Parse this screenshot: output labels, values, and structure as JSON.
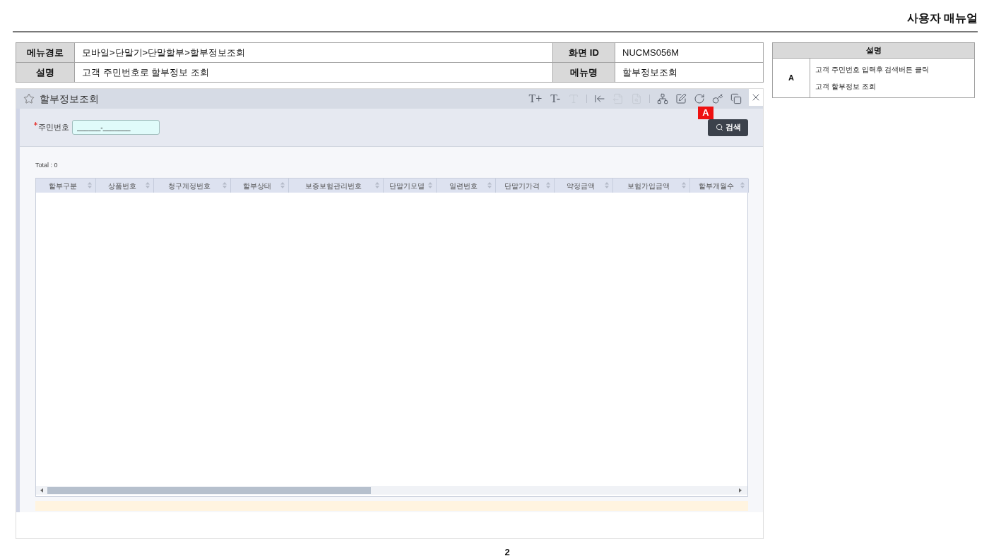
{
  "header": {
    "title": "사용자 매뉴얼"
  },
  "info_table": {
    "rows": [
      {
        "cells": [
          {
            "label": "메뉴경로",
            "value": "모바일>단말기>단말할부>할부정보조회"
          },
          {
            "label": "화면 ID",
            "value": "NUCMS056M"
          }
        ]
      },
      {
        "cells": [
          {
            "label": "설명",
            "value": "고객 주민번호로 할부정보 조회"
          },
          {
            "label": "메뉴명",
            "value": "할부정보조회"
          }
        ]
      }
    ]
  },
  "description_panel": {
    "title": "설명",
    "items": [
      {
        "marker": "A",
        "lines": [
          "고객 주민번호 입력후 검색버튼 클릭",
          "고객 할부정보 조회"
        ]
      }
    ]
  },
  "screen": {
    "window_title": "할부정보조회",
    "favorite": false,
    "toolbar": [
      {
        "kind": "text",
        "label": "T+",
        "disabled": false
      },
      {
        "kind": "text",
        "label": "T-",
        "disabled": false
      },
      {
        "kind": "type",
        "disabled": true
      },
      {
        "kind": "separator"
      },
      {
        "kind": "import",
        "disabled": false
      },
      {
        "kind": "export",
        "disabled": true
      },
      {
        "kind": "file",
        "disabled": true
      },
      {
        "kind": "separator"
      },
      {
        "kind": "network",
        "disabled": false
      },
      {
        "kind": "pen",
        "disabled": false
      },
      {
        "kind": "refresh",
        "disabled": false
      },
      {
        "kind": "key",
        "disabled": false
      },
      {
        "kind": "windows",
        "disabled": false
      },
      {
        "kind": "close",
        "disabled": false
      }
    ],
    "search_form": {
      "fields": [
        {
          "label": "주민번호",
          "required": true,
          "value": "______-_______"
        }
      ],
      "search_button": "검색",
      "annotation": "A"
    },
    "grid": {
      "total": "Total : 0",
      "columns": [
        {
          "label": "할부구분"
        },
        {
          "label": "상품번호"
        },
        {
          "label": "청구계정번호"
        },
        {
          "label": "할부상태"
        },
        {
          "label": "보증보험관리번호"
        },
        {
          "label": "단말기모델"
        },
        {
          "label": "일련번호"
        },
        {
          "label": "단말기가격"
        },
        {
          "label": "약정금액"
        },
        {
          "label": "보험가입금액"
        },
        {
          "label": "할부개월수"
        }
      ]
    }
  },
  "page_number": "2"
}
